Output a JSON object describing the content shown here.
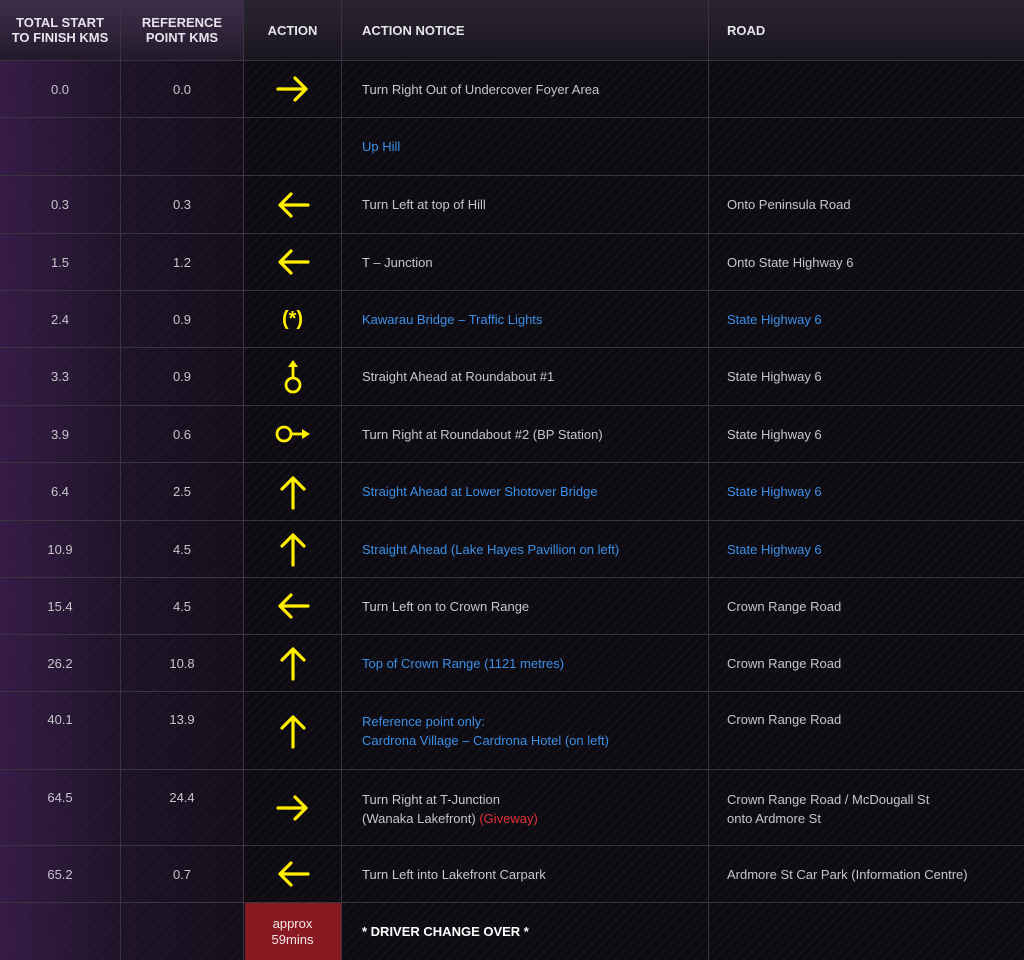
{
  "header": {
    "col_total": "TOTAL START\nTO FINISH KMS",
    "col_total_l1": "TOTAL START",
    "col_total_l2": "TO FINISH KMS",
    "col_ref_l1": "REFERENCE",
    "col_ref_l2": "POINT KMS",
    "col_action": "ACTION",
    "col_notice": "ACTION NOTICE",
    "col_road": "ROAD"
  },
  "rows": [
    {
      "total": "0.0",
      "ref": "0.0",
      "icon": "arrow-right-icon",
      "notice": "Turn Right Out of Undercover Foyer Area",
      "notice_color": "grey",
      "road": "",
      "road_color": "grey"
    },
    {
      "total": "",
      "ref": "",
      "icon": "",
      "notice": "Up Hill",
      "notice_color": "blue",
      "road": "",
      "road_color": "grey"
    },
    {
      "total": "0.3",
      "ref": "0.3",
      "icon": "arrow-left-icon",
      "notice": "Turn Left at top of Hill",
      "notice_color": "grey",
      "road": "Onto Peninsula Road",
      "road_color": "grey"
    },
    {
      "total": "1.5",
      "ref": "1.2",
      "icon": "arrow-left-icon",
      "notice": "T – Junction",
      "notice_color": "grey",
      "road": "Onto State Highway 6",
      "road_color": "grey"
    },
    {
      "total": "2.4",
      "ref": "0.9",
      "icon": "traffic-lights-icon",
      "icon_text": "(*)",
      "notice": "Kawarau Bridge – Traffic Lights",
      "notice_color": "blue",
      "road": "State Highway 6",
      "road_color": "blue"
    },
    {
      "total": "3.3",
      "ref": "0.9",
      "icon": "roundabout-straight-icon",
      "notice": "Straight Ahead at Roundabout #1",
      "notice_color": "grey",
      "road": "State Highway 6",
      "road_color": "grey"
    },
    {
      "total": "3.9",
      "ref": "0.6",
      "icon": "roundabout-right-icon",
      "notice": "Turn Right at Roundabout #2 (BP Station)",
      "notice_color": "grey",
      "road": "State Highway 6",
      "road_color": "grey"
    },
    {
      "total": "6.4",
      "ref": "2.5",
      "icon": "arrow-up-icon",
      "notice": "Straight Ahead at Lower Shotover Bridge",
      "notice_color": "blue",
      "road": "State Highway 6",
      "road_color": "blue"
    },
    {
      "total": "10.9",
      "ref": "4.5",
      "icon": "arrow-up-icon",
      "notice": "Straight Ahead (Lake Hayes Pavillion on left)",
      "notice_color": "blue",
      "road": "State Highway 6",
      "road_color": "blue"
    },
    {
      "total": "15.4",
      "ref": "4.5",
      "icon": "arrow-left-icon",
      "notice": "Turn Left on to Crown Range",
      "notice_color": "grey",
      "road": "Crown Range Road",
      "road_color": "grey"
    },
    {
      "total": "26.2",
      "ref": "10.8",
      "icon": "arrow-up-icon",
      "notice": "Top of Crown Range (1121 metres)",
      "notice_color": "blue",
      "road": "Crown Range Road",
      "road_color": "grey"
    },
    {
      "total": "40.1",
      "ref": "13.9",
      "icon": "arrow-up-icon",
      "notice_l1": "Reference point only:",
      "notice_l2": "Cardrona Village – Cardrona Hotel (on left)",
      "notice_color": "blue",
      "road": "Crown Range Road",
      "road_color": "grey"
    },
    {
      "total": "64.5",
      "ref": "24.4",
      "icon": "arrow-right-icon",
      "notice_l1": "Turn Right at T-Junction",
      "notice_l2": "(Wanaka Lakefront)",
      "notice_l2_extra": "(Giveway)",
      "notice_color": "grey",
      "road_l1": "Crown Range Road / McDougall St",
      "road_l2": "onto Ardmore St",
      "road_color": "grey"
    },
    {
      "total": "65.2",
      "ref": "0.7",
      "icon": "arrow-left-icon",
      "notice": "Turn Left into Lakefront Carpark",
      "notice_color": "grey",
      "road": "Ardmore St Car Park (Information Centre)",
      "road_color": "grey"
    },
    {
      "total": "",
      "ref": "",
      "approx_l1": "approx",
      "approx_l2": "59mins",
      "notice": "* DRIVER CHANGE OVER *",
      "road": ""
    }
  ],
  "colors": {
    "blue": "#3d8fe6",
    "red": "#e0303a",
    "icon_yellow": "#ffee00",
    "approx_bg": "#8a1a22"
  }
}
